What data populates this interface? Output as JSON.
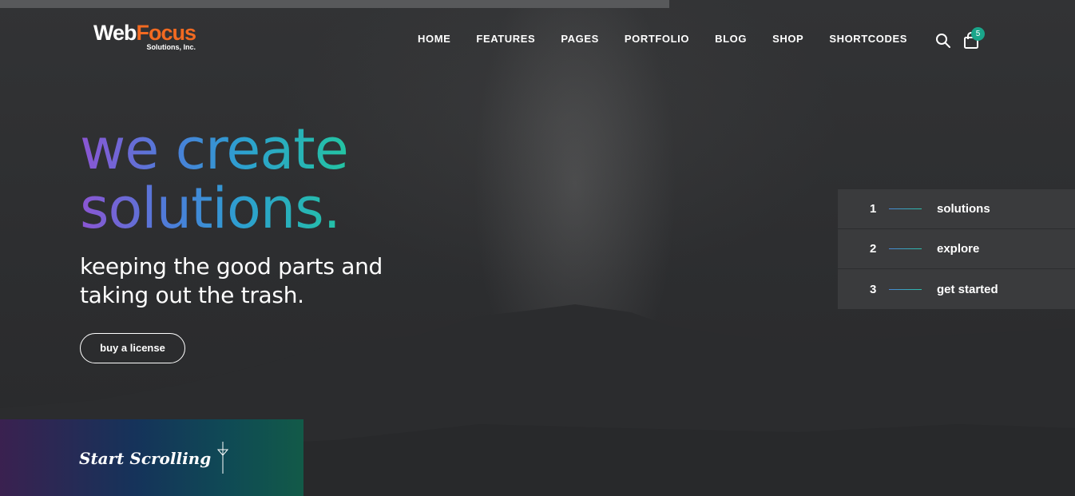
{
  "brand": {
    "name_part1": "Web",
    "name_part2": "Focus",
    "subtitle": "Solutions, Inc.",
    "accent_color": "#f26a21"
  },
  "nav": {
    "items": [
      {
        "label": "HOME"
      },
      {
        "label": "FEATURES"
      },
      {
        "label": "PAGES"
      },
      {
        "label": "PORTFOLIO"
      },
      {
        "label": "BLOG"
      },
      {
        "label": "SHOP"
      },
      {
        "label": "SHORTCODES"
      }
    ],
    "search_icon": "search-icon",
    "cart_icon": "shopping-bag-icon",
    "cart_count": "5"
  },
  "hero": {
    "title_line1": "we create",
    "title_line2": "solutions.",
    "subtitle_line1": "keeping the good parts and",
    "subtitle_line2": "taking out the trash.",
    "cta_label": "buy a license"
  },
  "steps": [
    {
      "number": "1",
      "label": "solutions"
    },
    {
      "number": "2",
      "label": "explore"
    },
    {
      "number": "3",
      "label": "get started"
    }
  ],
  "scroll": {
    "label": "Start Scrolling",
    "icon": "arrow-down-icon"
  }
}
